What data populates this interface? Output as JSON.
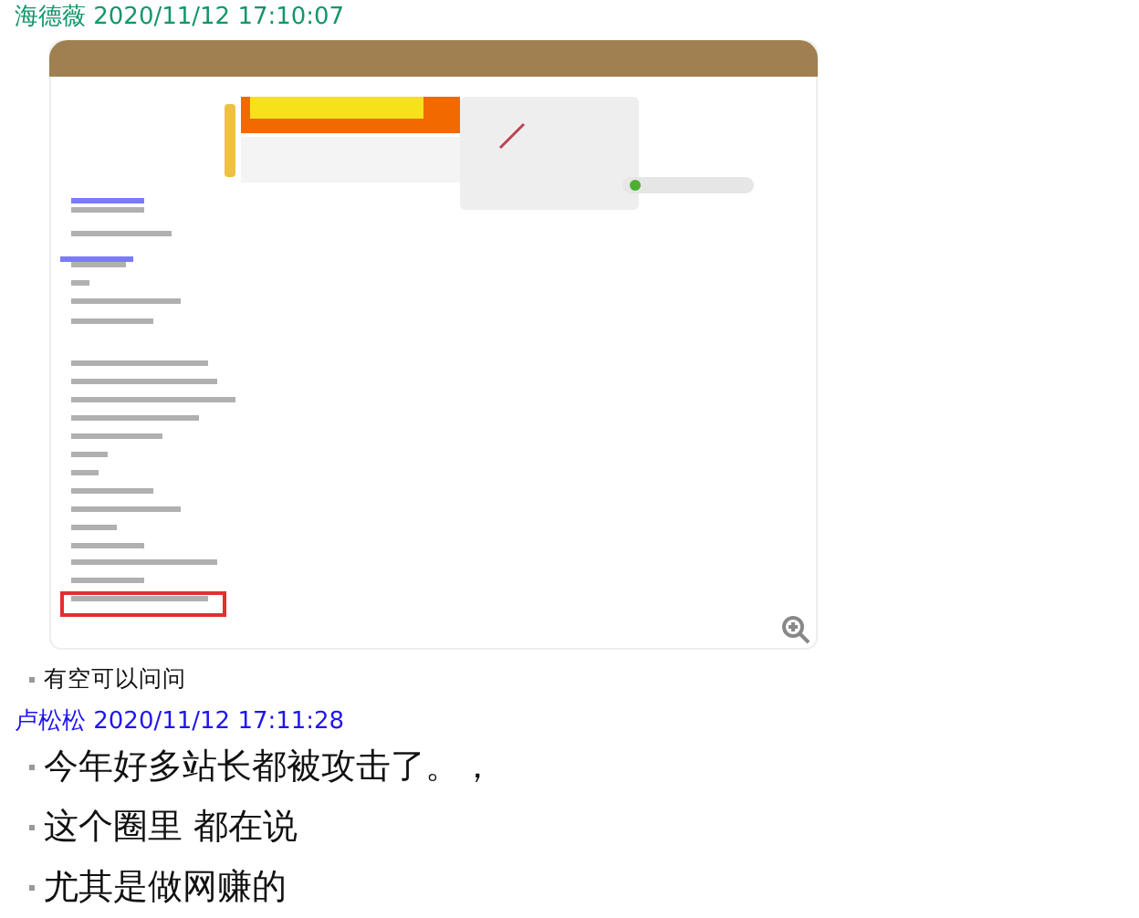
{
  "messages": [
    {
      "sender": "海德薇",
      "time": "2020/11/12 17:10:07",
      "color": "#13956b",
      "attachment": {
        "kind": "picture"
      },
      "lines": [
        {
          "text": "有空可以问问",
          "kind": "note"
        }
      ]
    },
    {
      "sender": "卢松松",
      "time": "2020/11/12 17:11:28",
      "color": "#1e14f0",
      "lines": [
        {
          "text": "今年好多站长都被攻击了。，",
          "kind": "headline"
        },
        {
          "text": "这个圈里 都在说",
          "kind": "headline"
        },
        {
          "text": "尤其是做网赚的",
          "kind": "headline"
        }
      ]
    }
  ]
}
